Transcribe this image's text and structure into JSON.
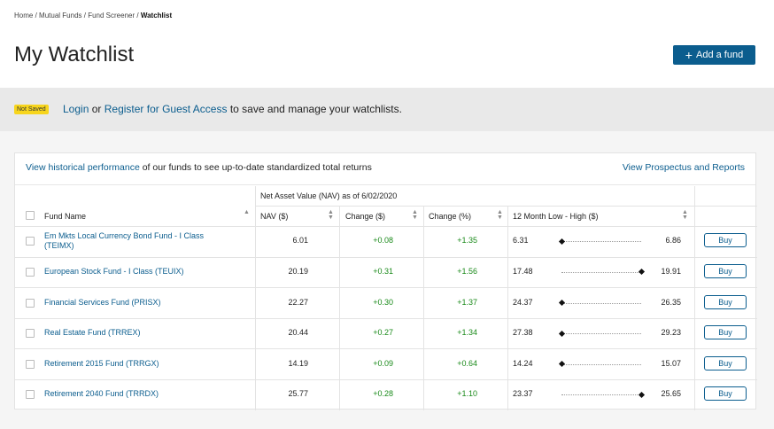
{
  "breadcrumb": [
    {
      "label": "Home"
    },
    {
      "label": "Mutual Funds"
    },
    {
      "label": "Fund Screener"
    },
    {
      "label": "Watchlist"
    }
  ],
  "breadcrumb_sep": "/",
  "page_title": "My Watchlist",
  "add_fund_label": "Add a fund",
  "banner": {
    "badge": "Not Saved",
    "login": "Login",
    "or": "or",
    "register": "Register for Guest Access",
    "rest": "to save and manage your watchlists."
  },
  "card": {
    "historical_link": "View historical performance",
    "historical_rest": "of our funds to see up-to-date standardized total returns",
    "prospectus_link": "View Prospectus and Reports",
    "nav_group": "Net Asset Value (NAV) as of 6/02/2020",
    "columns": {
      "fund_name": "Fund Name",
      "nav": "NAV ($)",
      "change_dollar": "Change ($)",
      "change_pct": "Change (%)",
      "range": "12 Month Low - High ($)"
    },
    "buy_label": "Buy",
    "rows": [
      {
        "name": "Em Mkts Local Currency Bond Fund - I Class (TEIMX)",
        "nav": "6.01",
        "chg": "+0.08",
        "pct": "+1.35",
        "low": "6.31",
        "high": "6.86",
        "pos": 0.0
      },
      {
        "name": "European Stock Fund - I Class (TEUIX)",
        "nav": "20.19",
        "chg": "+0.31",
        "pct": "+1.56",
        "low": "17.48",
        "high": "19.91",
        "pos": 1.0
      },
      {
        "name": "Financial Services Fund (PRISX)",
        "nav": "22.27",
        "chg": "+0.30",
        "pct": "+1.37",
        "low": "24.37",
        "high": "26.35",
        "pos": 0.0
      },
      {
        "name": "Real Estate Fund (TRREX)",
        "nav": "20.44",
        "chg": "+0.27",
        "pct": "+1.34",
        "low": "27.38",
        "high": "29.23",
        "pos": 0.0
      },
      {
        "name": "Retirement 2015 Fund (TRRGX)",
        "nav": "14.19",
        "chg": "+0.09",
        "pct": "+0.64",
        "low": "14.24",
        "high": "15.07",
        "pos": 0.0
      },
      {
        "name": "Retirement 2040 Fund (TRRDX)",
        "nav": "25.77",
        "chg": "+0.28",
        "pct": "+1.10",
        "low": "23.37",
        "high": "25.65",
        "pos": 1.0
      }
    ]
  },
  "colors": {
    "brand": "#0b5d8e",
    "positive": "#1a8a1a",
    "badge": "#f7d51d"
  }
}
